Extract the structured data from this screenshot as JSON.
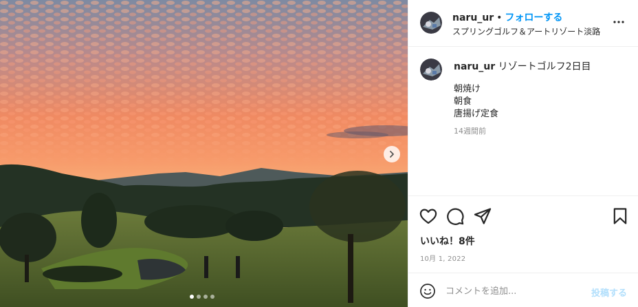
{
  "header": {
    "username": "naru_ur",
    "separator": "•",
    "follow_label": "フォローする",
    "location": "スプリングゴルフ＆アートリゾート淡路"
  },
  "caption": {
    "username": "naru_ur",
    "text": "リゾートゴルフ2日目",
    "lines": [
      "朝焼け",
      "朝食",
      "唐揚げ定食"
    ],
    "time_ago": "14週間前"
  },
  "stats": {
    "likes": "いいね！8件",
    "date": "10月 1, 2022"
  },
  "comment_box": {
    "placeholder": "コメントを追加...",
    "post_label": "投稿する"
  },
  "carousel": {
    "total": 4,
    "current": 1
  },
  "icons": {
    "more": "more-horizontal-icon",
    "next": "chevron-right-icon",
    "like": "heart-icon",
    "comment": "comment-icon",
    "share": "paper-plane-icon",
    "save": "bookmark-icon",
    "emoji": "smiley-icon"
  },
  "colors": {
    "follow": "#0095f6",
    "post_disabled": "#b2dffc",
    "secondary_text": "#8e8e8e",
    "border": "#efefef"
  }
}
